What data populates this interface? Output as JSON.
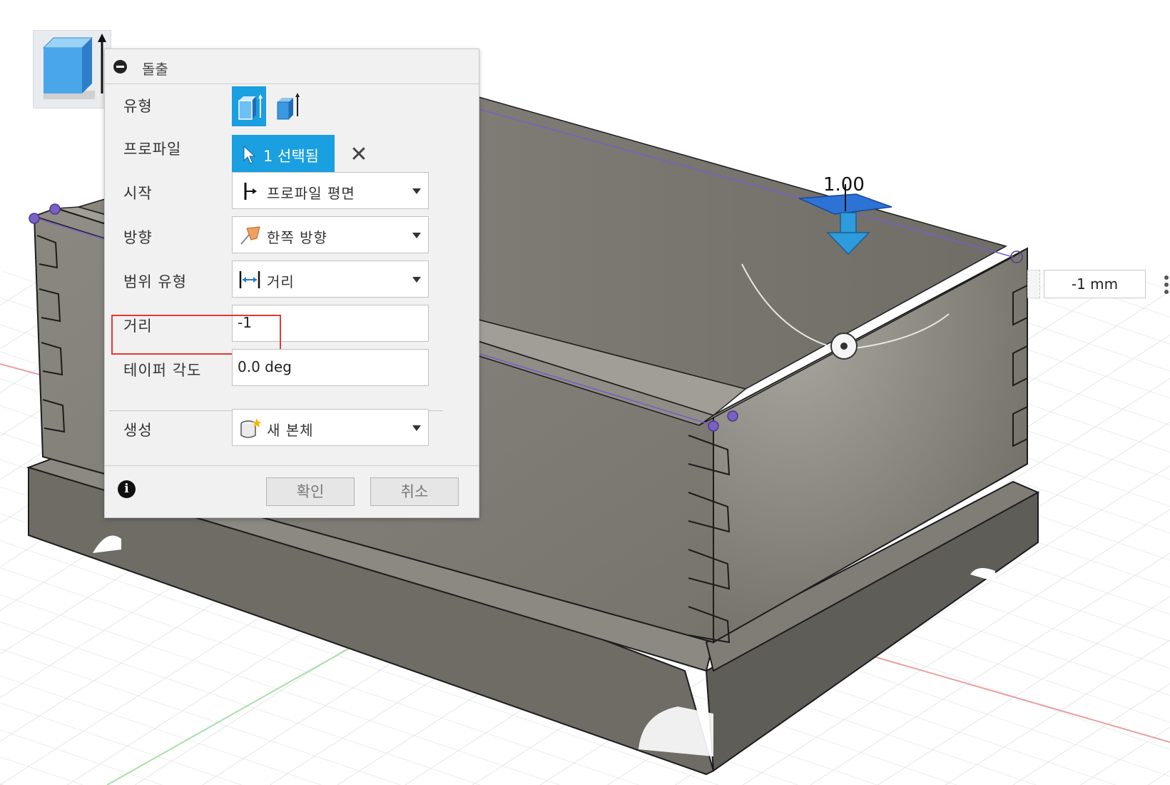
{
  "dialog": {
    "title": "돌출",
    "labels": {
      "type": "유형",
      "profile": "프로파일",
      "start": "시작",
      "direction": "방향",
      "extent_type": "범위 유형",
      "distance": "거리",
      "taper_angle": "테이퍼 각도",
      "operation": "생성"
    },
    "type_options": [
      "solid-extrude-icon",
      "thin-extrude-icon"
    ],
    "profile_selection": "1 선택됨",
    "start_value": "프로파일 평면",
    "direction_value": "한쪽 방향",
    "extent_value": "거리",
    "distance_value": "-1",
    "taper_value": "0.0 deg",
    "operation_value": "새 본체",
    "ok_label": "확인",
    "cancel_label": "취소"
  },
  "viewport": {
    "dimension_label": "1.00",
    "distance_input": "-1 mm"
  },
  "colors": {
    "accent": "#1a9fe0",
    "highlight": "#e53935",
    "model_face": "#7b7970",
    "model_edge": "#1c1c1c",
    "sketch_line": "#7a5fc4"
  }
}
